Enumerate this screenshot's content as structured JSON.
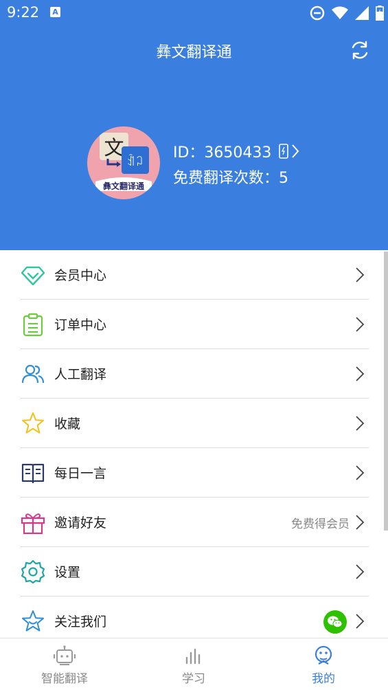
{
  "status_bar": {
    "time": "9:22",
    "notification_letter": "A"
  },
  "header": {
    "title": "彝文翻译通"
  },
  "profile": {
    "avatar_text_main": "文",
    "avatar_text_glyph": "ꀉꃀ",
    "avatar_caption": "彝文翻译通",
    "id_label": "ID：3650433",
    "free_translations": "免费翻译次数：5"
  },
  "menu": {
    "items": [
      {
        "label": "会员中心"
      },
      {
        "label": "订单中心"
      },
      {
        "label": "人工翻译"
      },
      {
        "label": "收藏"
      },
      {
        "label": "每日一言"
      },
      {
        "label": "邀请好友",
        "hint": "免费得会员"
      },
      {
        "label": "设置"
      },
      {
        "label": "关注我们"
      }
    ]
  },
  "tabbar": {
    "tabs": [
      {
        "label": "智能翻译"
      },
      {
        "label": "学习"
      },
      {
        "label": "我的"
      }
    ],
    "active_tab": "我的"
  },
  "colors": {
    "brand_blue": "#3a7fe0",
    "diamond_green": "#2ec7a0",
    "gift_pink": "#d63a87",
    "star_yellow": "#f2c11c",
    "wechat_green": "#2dc100"
  }
}
